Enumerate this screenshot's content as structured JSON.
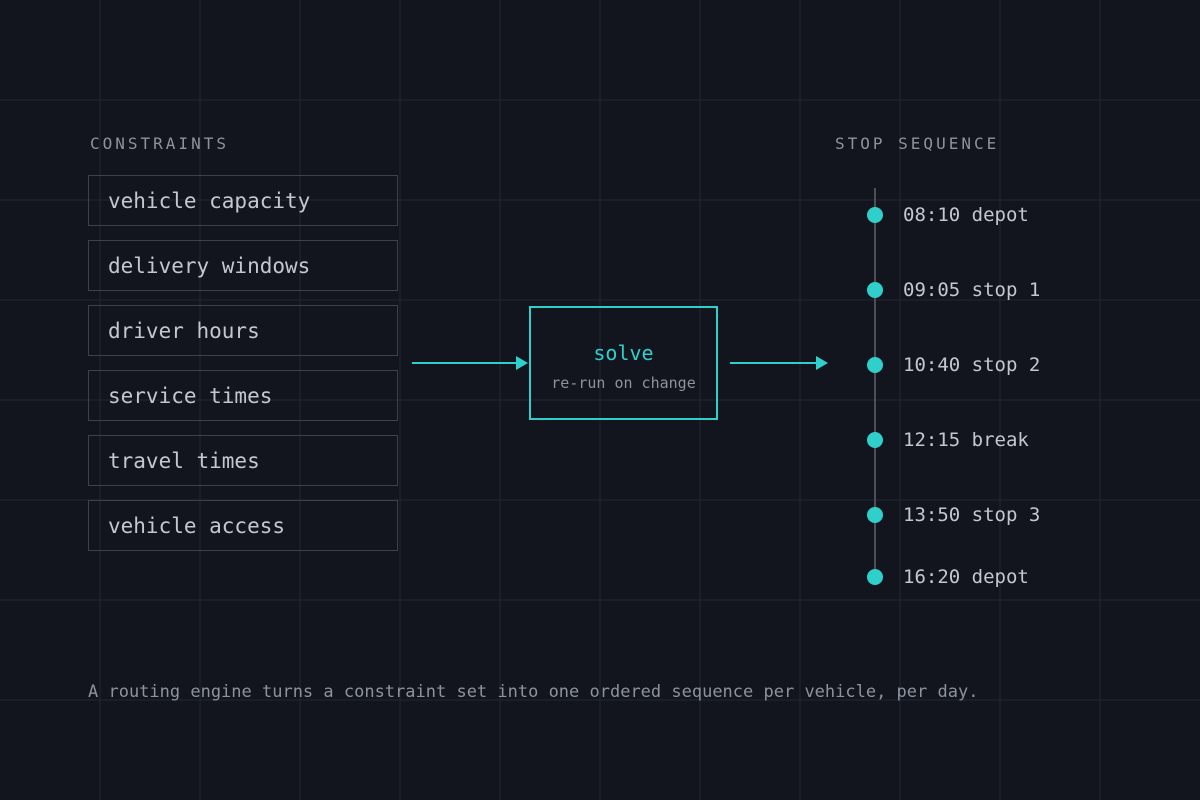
{
  "colors": {
    "background": "#12151d",
    "accent": "#2fd0cc",
    "grid": "#232833",
    "box_border": "#3c424c",
    "text": "#c3c8d0",
    "muted_text": "#8c939e"
  },
  "constraints": {
    "heading": "CONSTRAINTS",
    "items": [
      "vehicle capacity",
      "delivery windows",
      "driver hours",
      "service times",
      "travel times",
      "vehicle access"
    ]
  },
  "solver": {
    "title": "solve",
    "subtitle": "re-run on change"
  },
  "sequence": {
    "heading": "STOP SEQUENCE",
    "stops": [
      {
        "time": "08:10",
        "label": "depot"
      },
      {
        "time": "09:05",
        "label": "stop 1"
      },
      {
        "time": "10:40",
        "label": "stop 2"
      },
      {
        "time": "12:15",
        "label": "break"
      },
      {
        "time": "13:50",
        "label": "stop 3"
      },
      {
        "time": "16:20",
        "label": "depot"
      }
    ]
  },
  "caption": "A routing engine turns a constraint set into one ordered sequence per vehicle, per day."
}
